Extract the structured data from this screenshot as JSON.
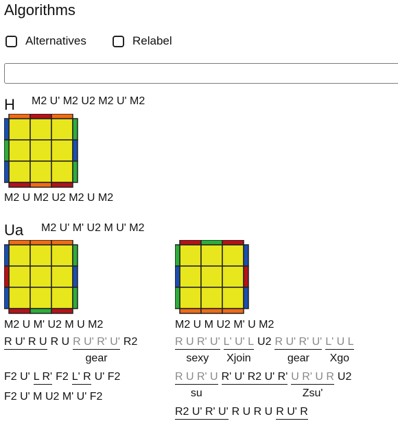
{
  "header": {
    "title": "Algorithms"
  },
  "options": {
    "alternatives_label": "Alternatives",
    "relabel_label": "Relabel"
  },
  "search": {
    "value": "",
    "placeholder": ""
  },
  "colors": {
    "yellow": "#e8e61c",
    "orange": "#ef6b15",
    "red": "#b51218",
    "green": "#2dad3a",
    "blue": "#1a4fb0",
    "black": "#222222"
  },
  "sections": {
    "h": {
      "label": "H",
      "main_alg": "M2 U' M2 U2 M2 U' M2",
      "cube": {
        "top": [
          "orange",
          "red",
          "orange"
        ],
        "bottom": [
          "red",
          "orange",
          "red"
        ],
        "left": [
          "blue",
          "green",
          "blue"
        ],
        "right": [
          "green",
          "blue",
          "green"
        ]
      },
      "alt_alg": "M2 U M2 U2 M2 U M2"
    },
    "ua": {
      "label": "Ua",
      "main_alg": "M2 U' M' U2 M U' M2",
      "cube1": {
        "top": [
          "orange",
          "orange",
          "orange"
        ],
        "bottom": [
          "red",
          "green",
          "red"
        ],
        "left": [
          "blue",
          "red",
          "blue"
        ],
        "right": [
          "green",
          "blue",
          "green"
        ]
      },
      "cube2": {
        "top": [
          "red",
          "green",
          "red"
        ],
        "bottom": [
          "orange",
          "orange",
          "orange"
        ],
        "left": [
          "green",
          "blue",
          "green"
        ],
        "right": [
          "blue",
          "red",
          "blue"
        ]
      },
      "left_col": {
        "alg": "M2 U M' U2 M U M2",
        "l2": {
          "g1": "R U' R U",
          "t1": "R U",
          "g2": "R U' R' U'",
          "g2_label": "gear",
          "t2": "R2"
        },
        "l3": {
          "t1": "F2 U'",
          "g1": "L R'",
          "t2": "F2",
          "g2": "L' R",
          "t3": "U' F2"
        },
        "l4": "F2 U' M U2 M' U' F2"
      },
      "right_col": {
        "alg": "M2 U M U2 M' U M2",
        "l2": {
          "g1": "R U R' U'",
          "g1_label": "sexy",
          "g2": "L' U' L",
          "g2_label": "Xjoin",
          "t1": "U2",
          "g3": "R U' R' U'",
          "g3_label": "gear",
          "g4": "L' U L",
          "g4_label": "Xgo"
        },
        "l3": {
          "g1": "R U R' U",
          "g1_label": "su",
          "g2": "R' U' R2 U' R'",
          "g3": "U R' U R",
          "g3_label": "Zsu'",
          "t1": "U2"
        },
        "l4": {
          "g1": "R2 U' R' U'",
          "t1": "R U R U",
          "g2": "R U' R"
        }
      }
    }
  }
}
